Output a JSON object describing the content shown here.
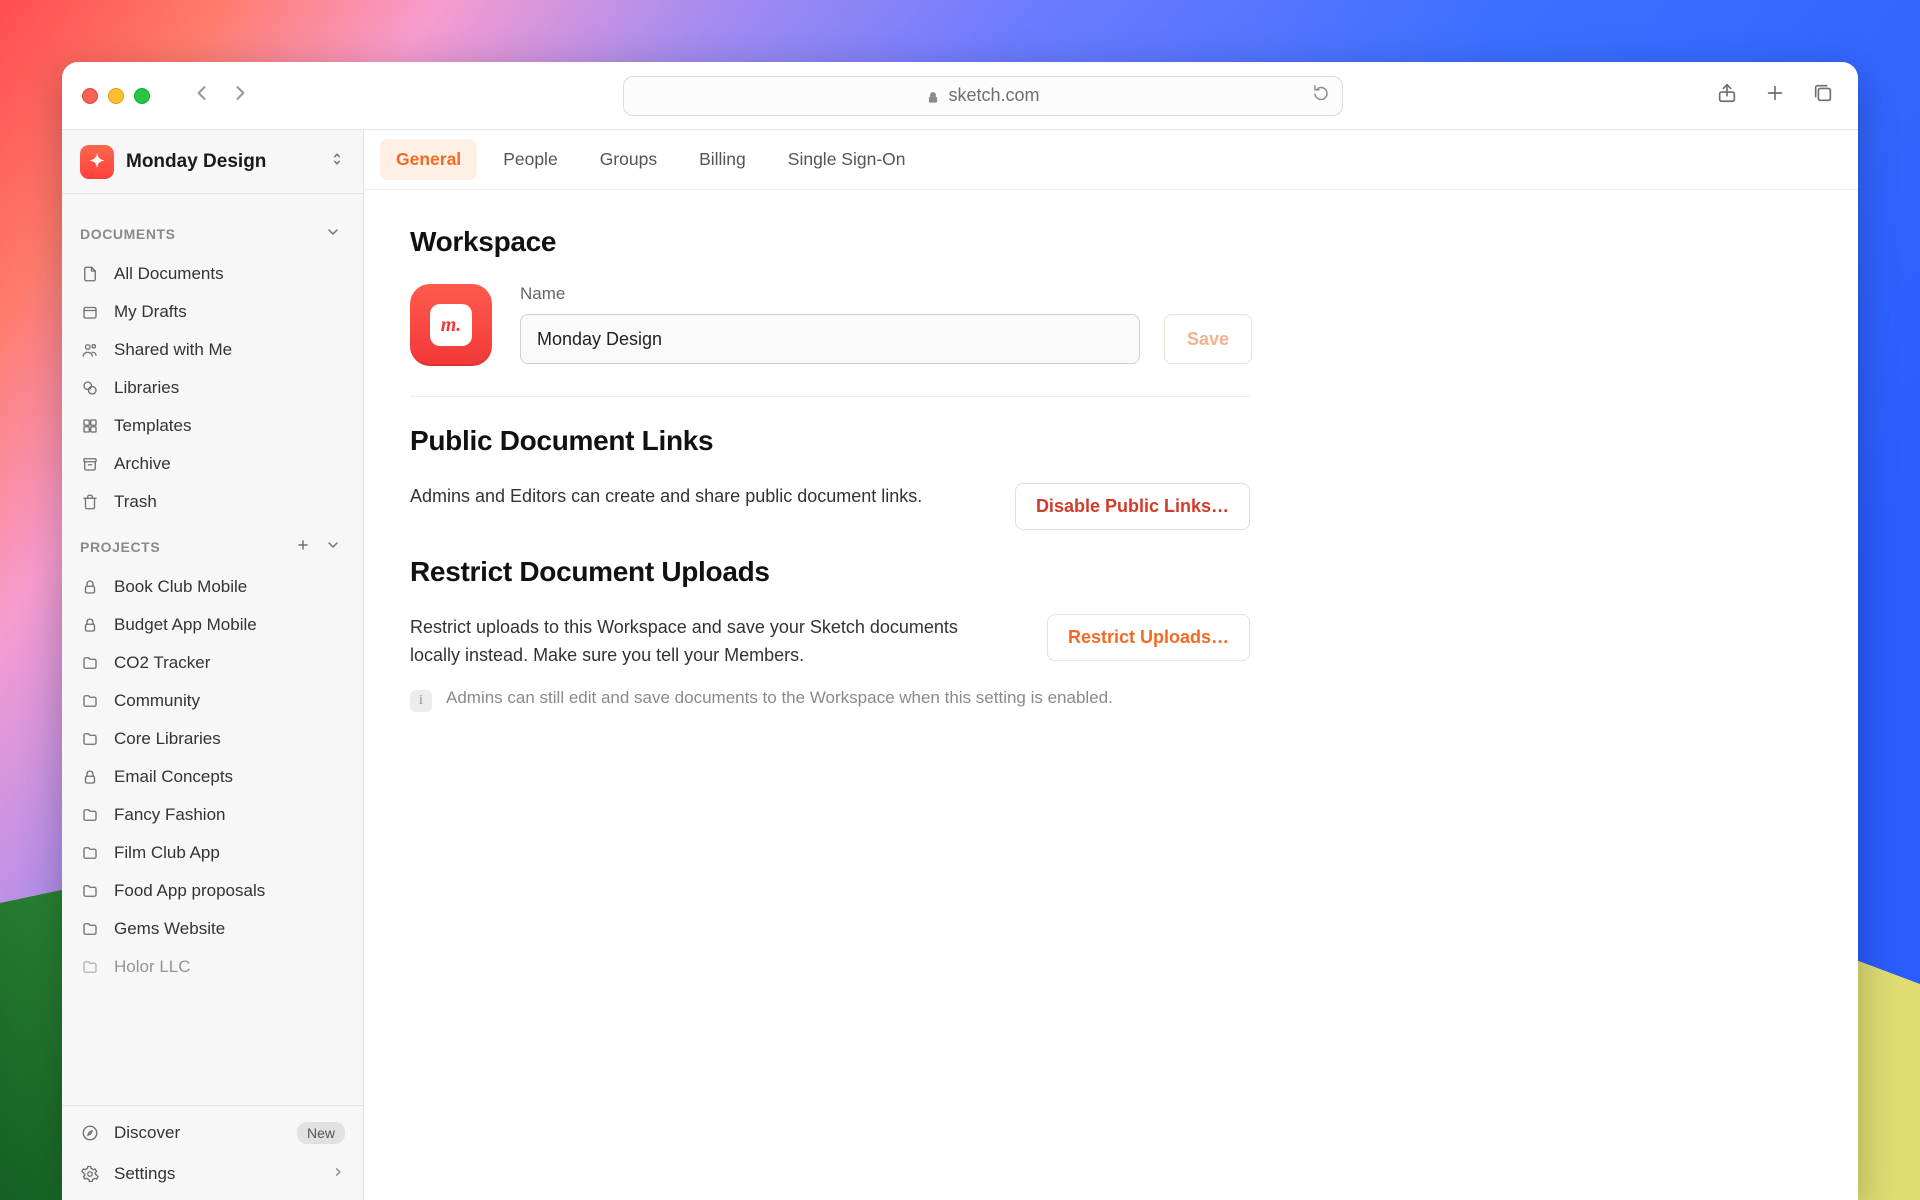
{
  "browser": {
    "url_host": "sketch.com"
  },
  "sidebar": {
    "workspace_name": "Monday Design",
    "documents_header": "DOCUMENTS",
    "projects_header": "PROJECTS",
    "docs": [
      {
        "label": "All Documents",
        "icon": "files"
      },
      {
        "label": "My Drafts",
        "icon": "drafts"
      },
      {
        "label": "Shared with Me",
        "icon": "shared"
      },
      {
        "label": "Libraries",
        "icon": "libraries"
      },
      {
        "label": "Templates",
        "icon": "templates"
      },
      {
        "label": "Archive",
        "icon": "archive"
      },
      {
        "label": "Trash",
        "icon": "trash"
      }
    ],
    "projects": [
      {
        "label": "Book Club Mobile",
        "locked": true
      },
      {
        "label": "Budget App Mobile",
        "locked": true
      },
      {
        "label": "CO2 Tracker",
        "locked": false
      },
      {
        "label": "Community",
        "locked": false
      },
      {
        "label": "Core Libraries",
        "locked": false
      },
      {
        "label": "Email Concepts",
        "locked": true
      },
      {
        "label": "Fancy Fashion",
        "locked": false
      },
      {
        "label": "Film Club App",
        "locked": false
      },
      {
        "label": "Food App proposals",
        "locked": false
      },
      {
        "label": "Gems Website",
        "locked": false
      },
      {
        "label": "Holor LLC",
        "locked": false
      }
    ],
    "footer": {
      "discover": "Discover",
      "discover_badge": "New",
      "settings": "Settings"
    }
  },
  "tabs": [
    {
      "label": "General",
      "active": true
    },
    {
      "label": "People",
      "active": false
    },
    {
      "label": "Groups",
      "active": false
    },
    {
      "label": "Billing",
      "active": false
    },
    {
      "label": "Single Sign-On",
      "active": false
    }
  ],
  "main": {
    "workspace_title": "Workspace",
    "name_label": "Name",
    "name_value": "Monday Design",
    "save_label": "Save",
    "public_links_title": "Public Document Links",
    "public_links_desc": "Admins and Editors can create and share public document links.",
    "disable_public_links_label": "Disable Public Links…",
    "restrict_title": "Restrict Document Uploads",
    "restrict_desc": "Restrict uploads to this Workspace and save your Sketch documents locally instead. Make sure you tell your Members.",
    "restrict_button_label": "Restrict Uploads…",
    "restrict_info": "Admins can still edit and save documents to the Workspace when this setting is enabled."
  }
}
